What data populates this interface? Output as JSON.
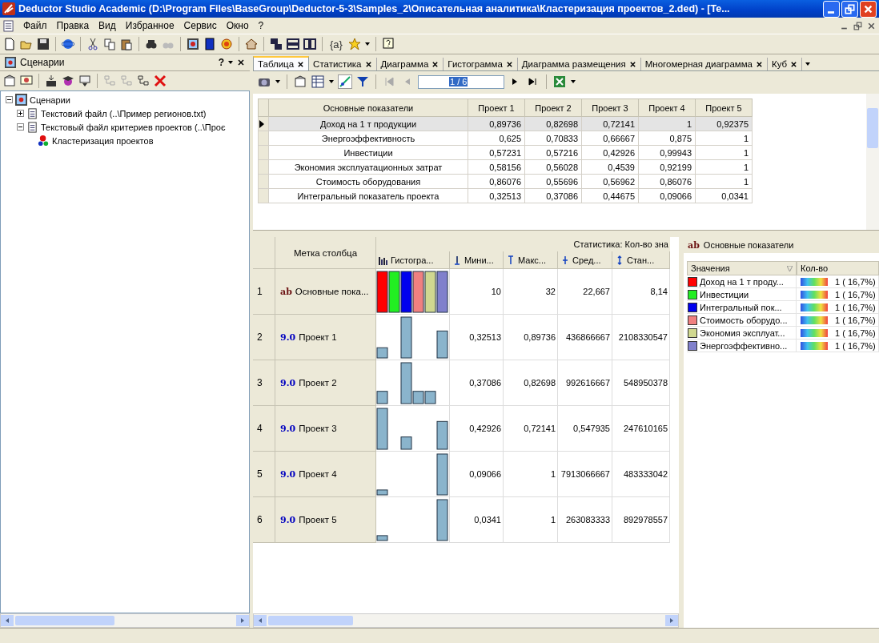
{
  "window": {
    "title": "Deductor Studio Academic (D:\\Program Files\\BaseGroup\\Deductor-5-3\\Samples_2\\Описательная аналитика\\Кластеризация проектов_2.ded) - [Te..."
  },
  "menu": [
    "Файл",
    "Правка",
    "Вид",
    "Избранное",
    "Сервис",
    "Окно",
    "?"
  ],
  "toolbar": {
    "text_button": "{a}"
  },
  "scenarios": {
    "title": "Сценарии",
    "help": "?",
    "tree": [
      {
        "label": "Сценарии",
        "expanded": true,
        "children": [
          {
            "label": "Текстовий файл (..\\Пример регионов.txt)",
            "expanded": false
          },
          {
            "label": "Текстовый файл критериев проектов (..\\Проє",
            "expanded": true,
            "children": [
              {
                "label": "Кластеризация проектов"
              }
            ]
          }
        ]
      }
    ]
  },
  "tabs": [
    {
      "label": "Таблица",
      "selected": true
    },
    {
      "label": "Статистика",
      "selected": false
    },
    {
      "label": "Диаграмма",
      "selected": false
    },
    {
      "label": "Гистограмма",
      "selected": false
    },
    {
      "label": "Диаграмма размещения",
      "selected": false
    },
    {
      "label": "Многомерная диаграмма",
      "selected": false
    },
    {
      "label": "Куб",
      "selected": false
    }
  ],
  "navigator": {
    "value": "1 / 6"
  },
  "table": {
    "columns": [
      "Основные показатели",
      "Проект 1",
      "Проект 2",
      "Проект 3",
      "Проект 4",
      "Проект 5"
    ],
    "rows": [
      {
        "selected": true,
        "cells": [
          "Доход на 1 т продукции",
          "0,89736",
          "0,82698",
          "0,72141",
          "1",
          "0,92375"
        ]
      },
      {
        "selected": false,
        "cells": [
          "Энергоэффективность",
          "0,625",
          "0,70833",
          "0,66667",
          "0,875",
          "1"
        ]
      },
      {
        "selected": false,
        "cells": [
          "Инвестиции",
          "0,57231",
          "0,57216",
          "0,42926",
          "0,99943",
          "1"
        ]
      },
      {
        "selected": false,
        "cells": [
          "Экономия эксплуатационных затрат",
          "0,58156",
          "0,56028",
          "0,4539",
          "0,92199",
          "1"
        ]
      },
      {
        "selected": false,
        "cells": [
          "Стоимость оборудования",
          "0,86076",
          "0,55696",
          "0,56962",
          "0,86076",
          "1"
        ]
      },
      {
        "selected": false,
        "cells": [
          "Интегральный показатель проекта",
          "0,32513",
          "0,37086",
          "0,44675",
          "0,09066",
          "0,0341"
        ]
      }
    ]
  },
  "statistics": {
    "label_header": "Метка столбца",
    "group_header": "Статистика: Кол-во зна",
    "columns": [
      "Гистогра...",
      "Мини...",
      "Макс...",
      "Сред...",
      "Стан..."
    ],
    "rows": [
      {
        "number": "1",
        "type": "ab",
        "kind": "string",
        "label": "Основные пока...",
        "min": "10",
        "max": "32",
        "mean": "22,667",
        "std": "8,14"
      },
      {
        "number": "2",
        "type": "9.0",
        "kind": "number",
        "label": "Проект 1",
        "min": "0,32513",
        "max": "0,89736",
        "mean": "436866667",
        "std": "2108330547"
      },
      {
        "number": "3",
        "type": "9.0",
        "kind": "number",
        "label": "Проект 2",
        "min": "0,37086",
        "max": "0,82698",
        "mean": "992616667",
        "std": "548950378"
      },
      {
        "number": "4",
        "type": "9.0",
        "kind": "number",
        "label": "Проект 3",
        "min": "0,42926",
        "max": "0,72141",
        "mean": "0,547935",
        "std": "247610165"
      },
      {
        "number": "5",
        "type": "9.0",
        "kind": "number",
        "label": "Проект 4",
        "min": "0,09066",
        "max": "1",
        "mean": "7913066667",
        "std": "483333042"
      },
      {
        "number": "6",
        "type": "9.0",
        "kind": "number",
        "label": "Проект 5",
        "min": "0,0341",
        "max": "1",
        "mean": "263083333",
        "std": "892978557"
      }
    ]
  },
  "details": {
    "type": "ab",
    "title": "Основные показатели",
    "columns": [
      "Значения",
      "Кол-во"
    ],
    "rows": [
      {
        "label": "Доход на 1 т проду...",
        "color": "#ff0000",
        "count": "1 ( 16,7%)"
      },
      {
        "label": "Инвестиции",
        "color": "#22ee22",
        "count": "1 ( 16,7%)"
      },
      {
        "label": "Интегральный пок...",
        "color": "#0000ee",
        "count": "1 ( 16,7%)"
      },
      {
        "label": "Стоимость оборудо...",
        "color": "#f08080",
        "count": "1 ( 16,7%)"
      },
      {
        "label": "Экономия эксплуат...",
        "color": "#d0d890",
        "count": "1 ( 16,7%)"
      },
      {
        "label": "Энергоэффективно...",
        "color": "#8080cc",
        "count": "1 ( 16,7%)"
      }
    ]
  }
}
